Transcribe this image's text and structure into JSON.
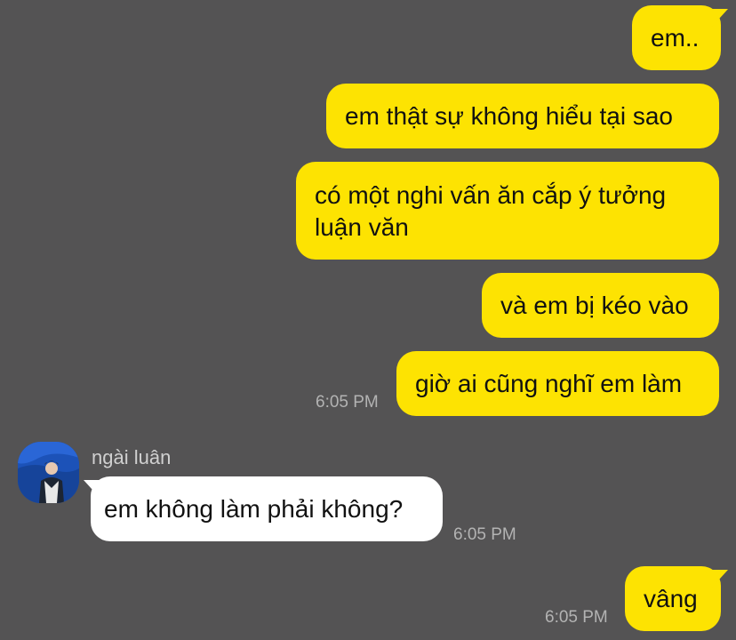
{
  "messages": [
    {
      "text": "em.."
    },
    {
      "text": "em thật sự không hiểu tại sao"
    },
    {
      "text": "có một nghi vấn ăn cắp ý tưởng",
      "text2": "luận văn"
    },
    {
      "text": "và em bị kéo vào"
    },
    {
      "text": "giờ ai cũng nghĩ em làm",
      "time": "6:05 PM"
    },
    {
      "sender": "ngài luân",
      "text": "em không làm phải không?",
      "time": "6:05 PM"
    },
    {
      "text": "vâng",
      "time": "6:05 PM"
    }
  ],
  "colors": {
    "background": "#545354",
    "outgoing": "#FDE302",
    "incoming": "#FFFFFF"
  },
  "icons": {
    "avatar": "profile-photo"
  }
}
